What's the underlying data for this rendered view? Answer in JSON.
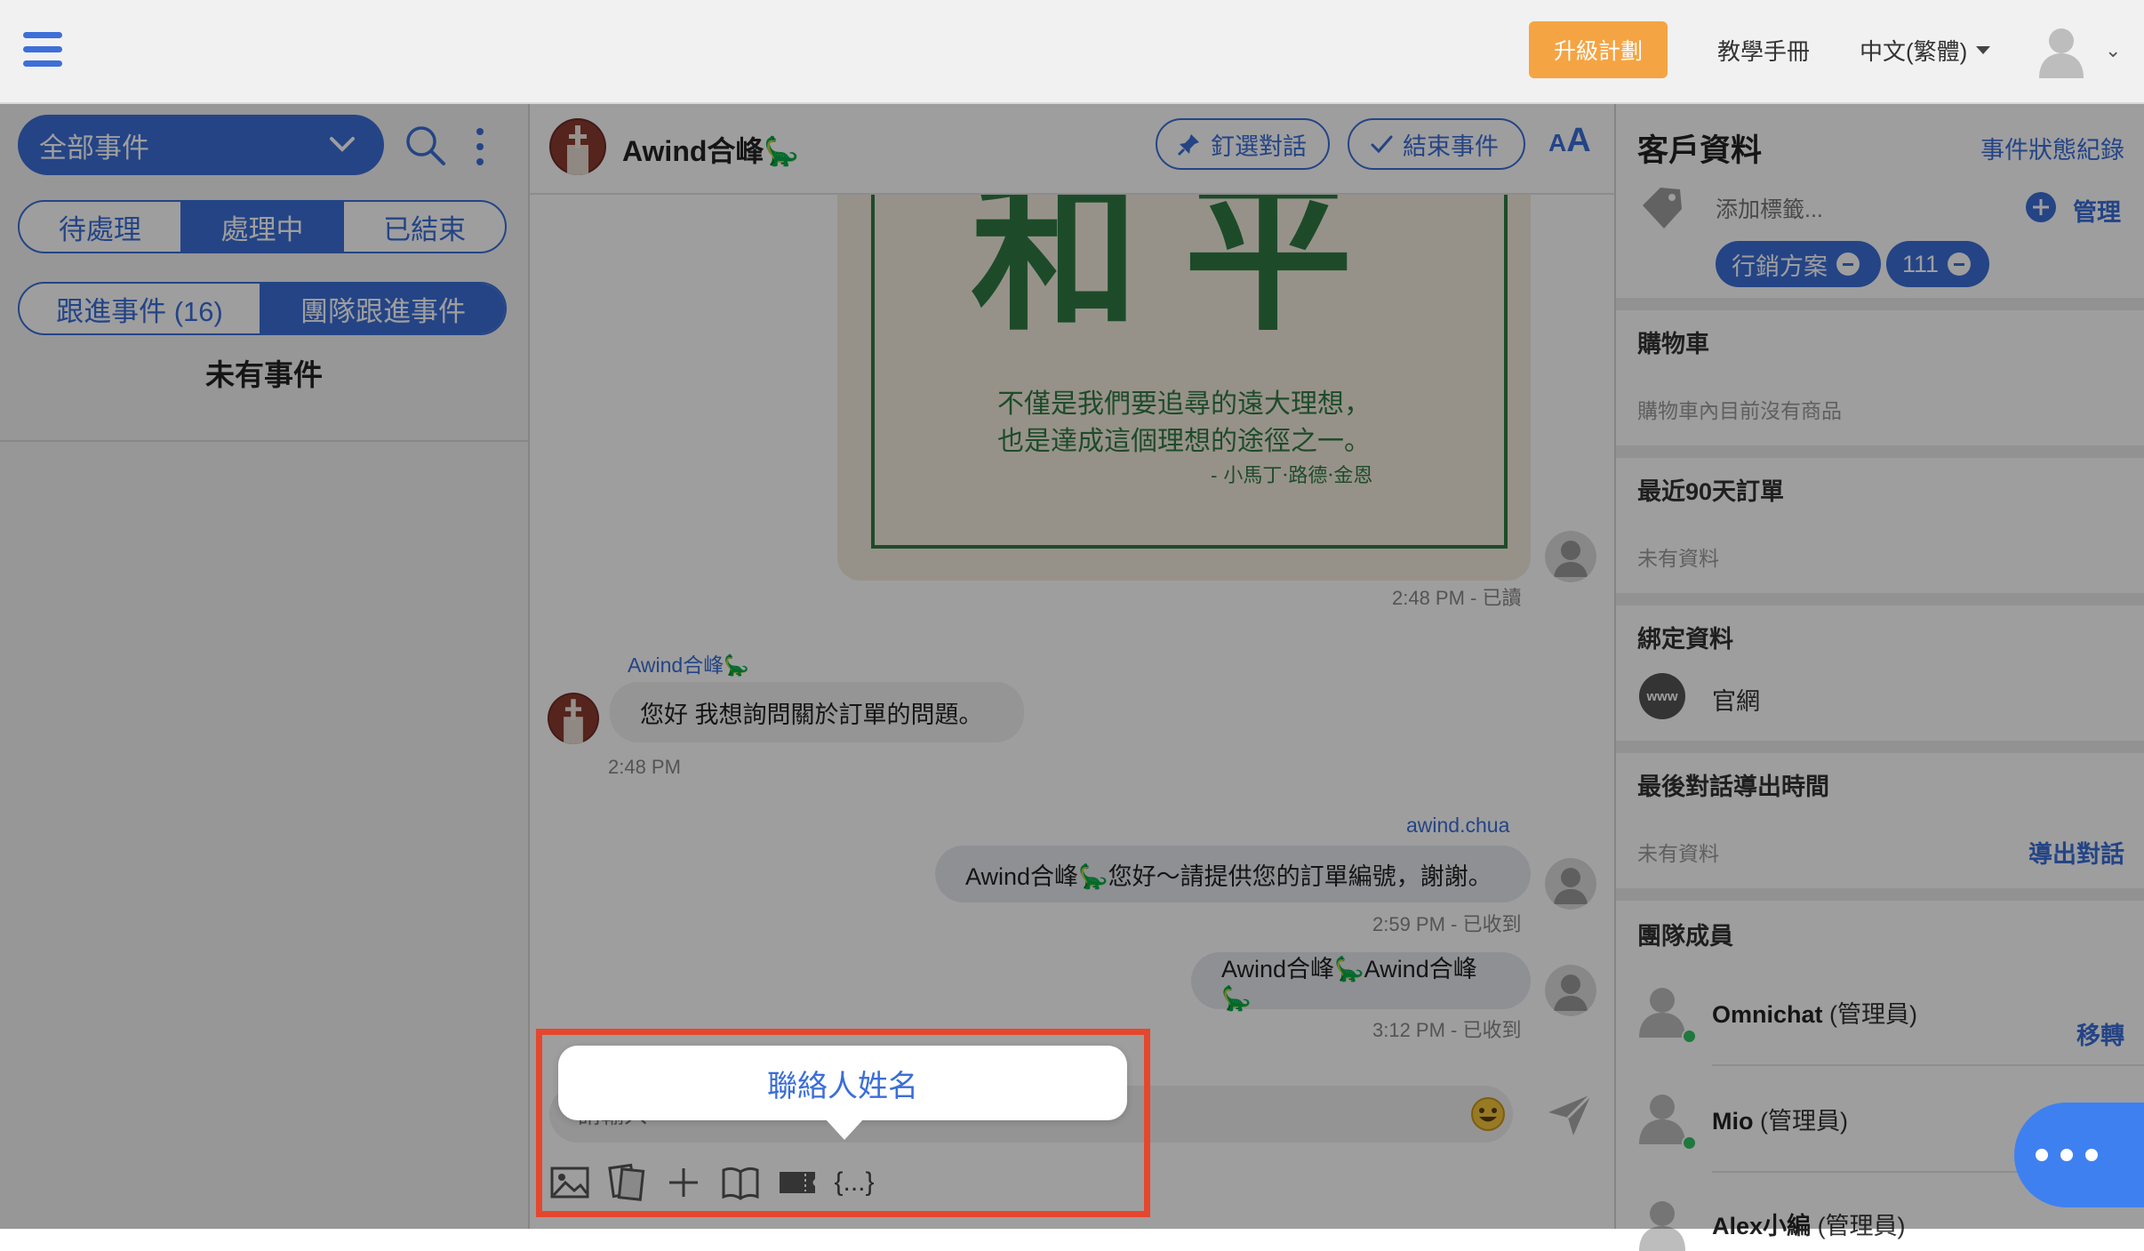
{
  "topbar": {
    "upgrade_label": "升級計劃",
    "manual_label": "教學手冊",
    "language_label": "中文(繁體)"
  },
  "left": {
    "filter_label": "全部事件",
    "status_tabs": [
      "待處理",
      "處理中",
      "已結束"
    ],
    "active_status_index": 1,
    "followup_tabs": [
      "跟進事件 (16)",
      "團隊跟進事件"
    ],
    "active_followup_index": 1,
    "empty_text": "未有事件"
  },
  "chat": {
    "contact_name": "Awind合峰🦕",
    "pin_label": "釘選對話",
    "close_label": "結束事件",
    "font_size_label_small": "A",
    "font_size_label_big": "A",
    "poster": {
      "big_text": "和平",
      "line1": "不僅是我們要追尋的遠大理想，",
      "line2": "也是達成這個理想的途徑之一。",
      "author": "- 小馬丁·路德·金恩"
    },
    "messages": [
      {
        "meta": "2:48 PM - 已讀"
      },
      {
        "sender": "Awind合峰🦕",
        "text": "您好 我想詢問關於訂單的問題。",
        "time": "2:48 PM"
      },
      {
        "sender": "awind.chua",
        "text": "Awind合峰🦕您好～請提供您的訂單編號，謝謝。",
        "time": "2:59 PM - 已收到"
      },
      {
        "text": "Awind合峰🦕Awind合峰🦕",
        "time": "3:12 PM - 已收到"
      }
    ],
    "composer_placeholder": "請輸入",
    "toolbar_icons": [
      "image-icon",
      "gallery-icon",
      "plus-icon",
      "book-icon",
      "ticket-icon",
      "variable-icon"
    ],
    "variable_symbol": "{...}",
    "tooltip_text": "聯絡人姓名"
  },
  "right": {
    "title": "客戶資料",
    "log_link": "事件狀態紀錄",
    "tag_placeholder": "添加標籤...",
    "manage_label": "管理",
    "tags": [
      "行銷方案",
      "111"
    ],
    "cart_title": "購物車",
    "cart_empty": "購物車內目前沒有商品",
    "orders_title": "最近90天訂單",
    "orders_empty": "未有資料",
    "binding_title": "綁定資料",
    "binding_icon_text": "www",
    "binding_label": "官網",
    "export_title": "最後對話導出時間",
    "export_empty": "未有資料",
    "export_link": "導出對話",
    "team_title": "團隊成員",
    "members": [
      {
        "name": "Omnichat",
        "role": "(管理員)"
      },
      {
        "name": "Mio",
        "role": "(管理員)"
      },
      {
        "name": "Alex小編",
        "role": "(管理員)"
      }
    ],
    "transfer_label": "移轉"
  },
  "colors": {
    "primary": "#3a6ed8",
    "upgrade": "#f5a443",
    "highlight": "#e5472e",
    "poster_green": "#2f7a44"
  }
}
